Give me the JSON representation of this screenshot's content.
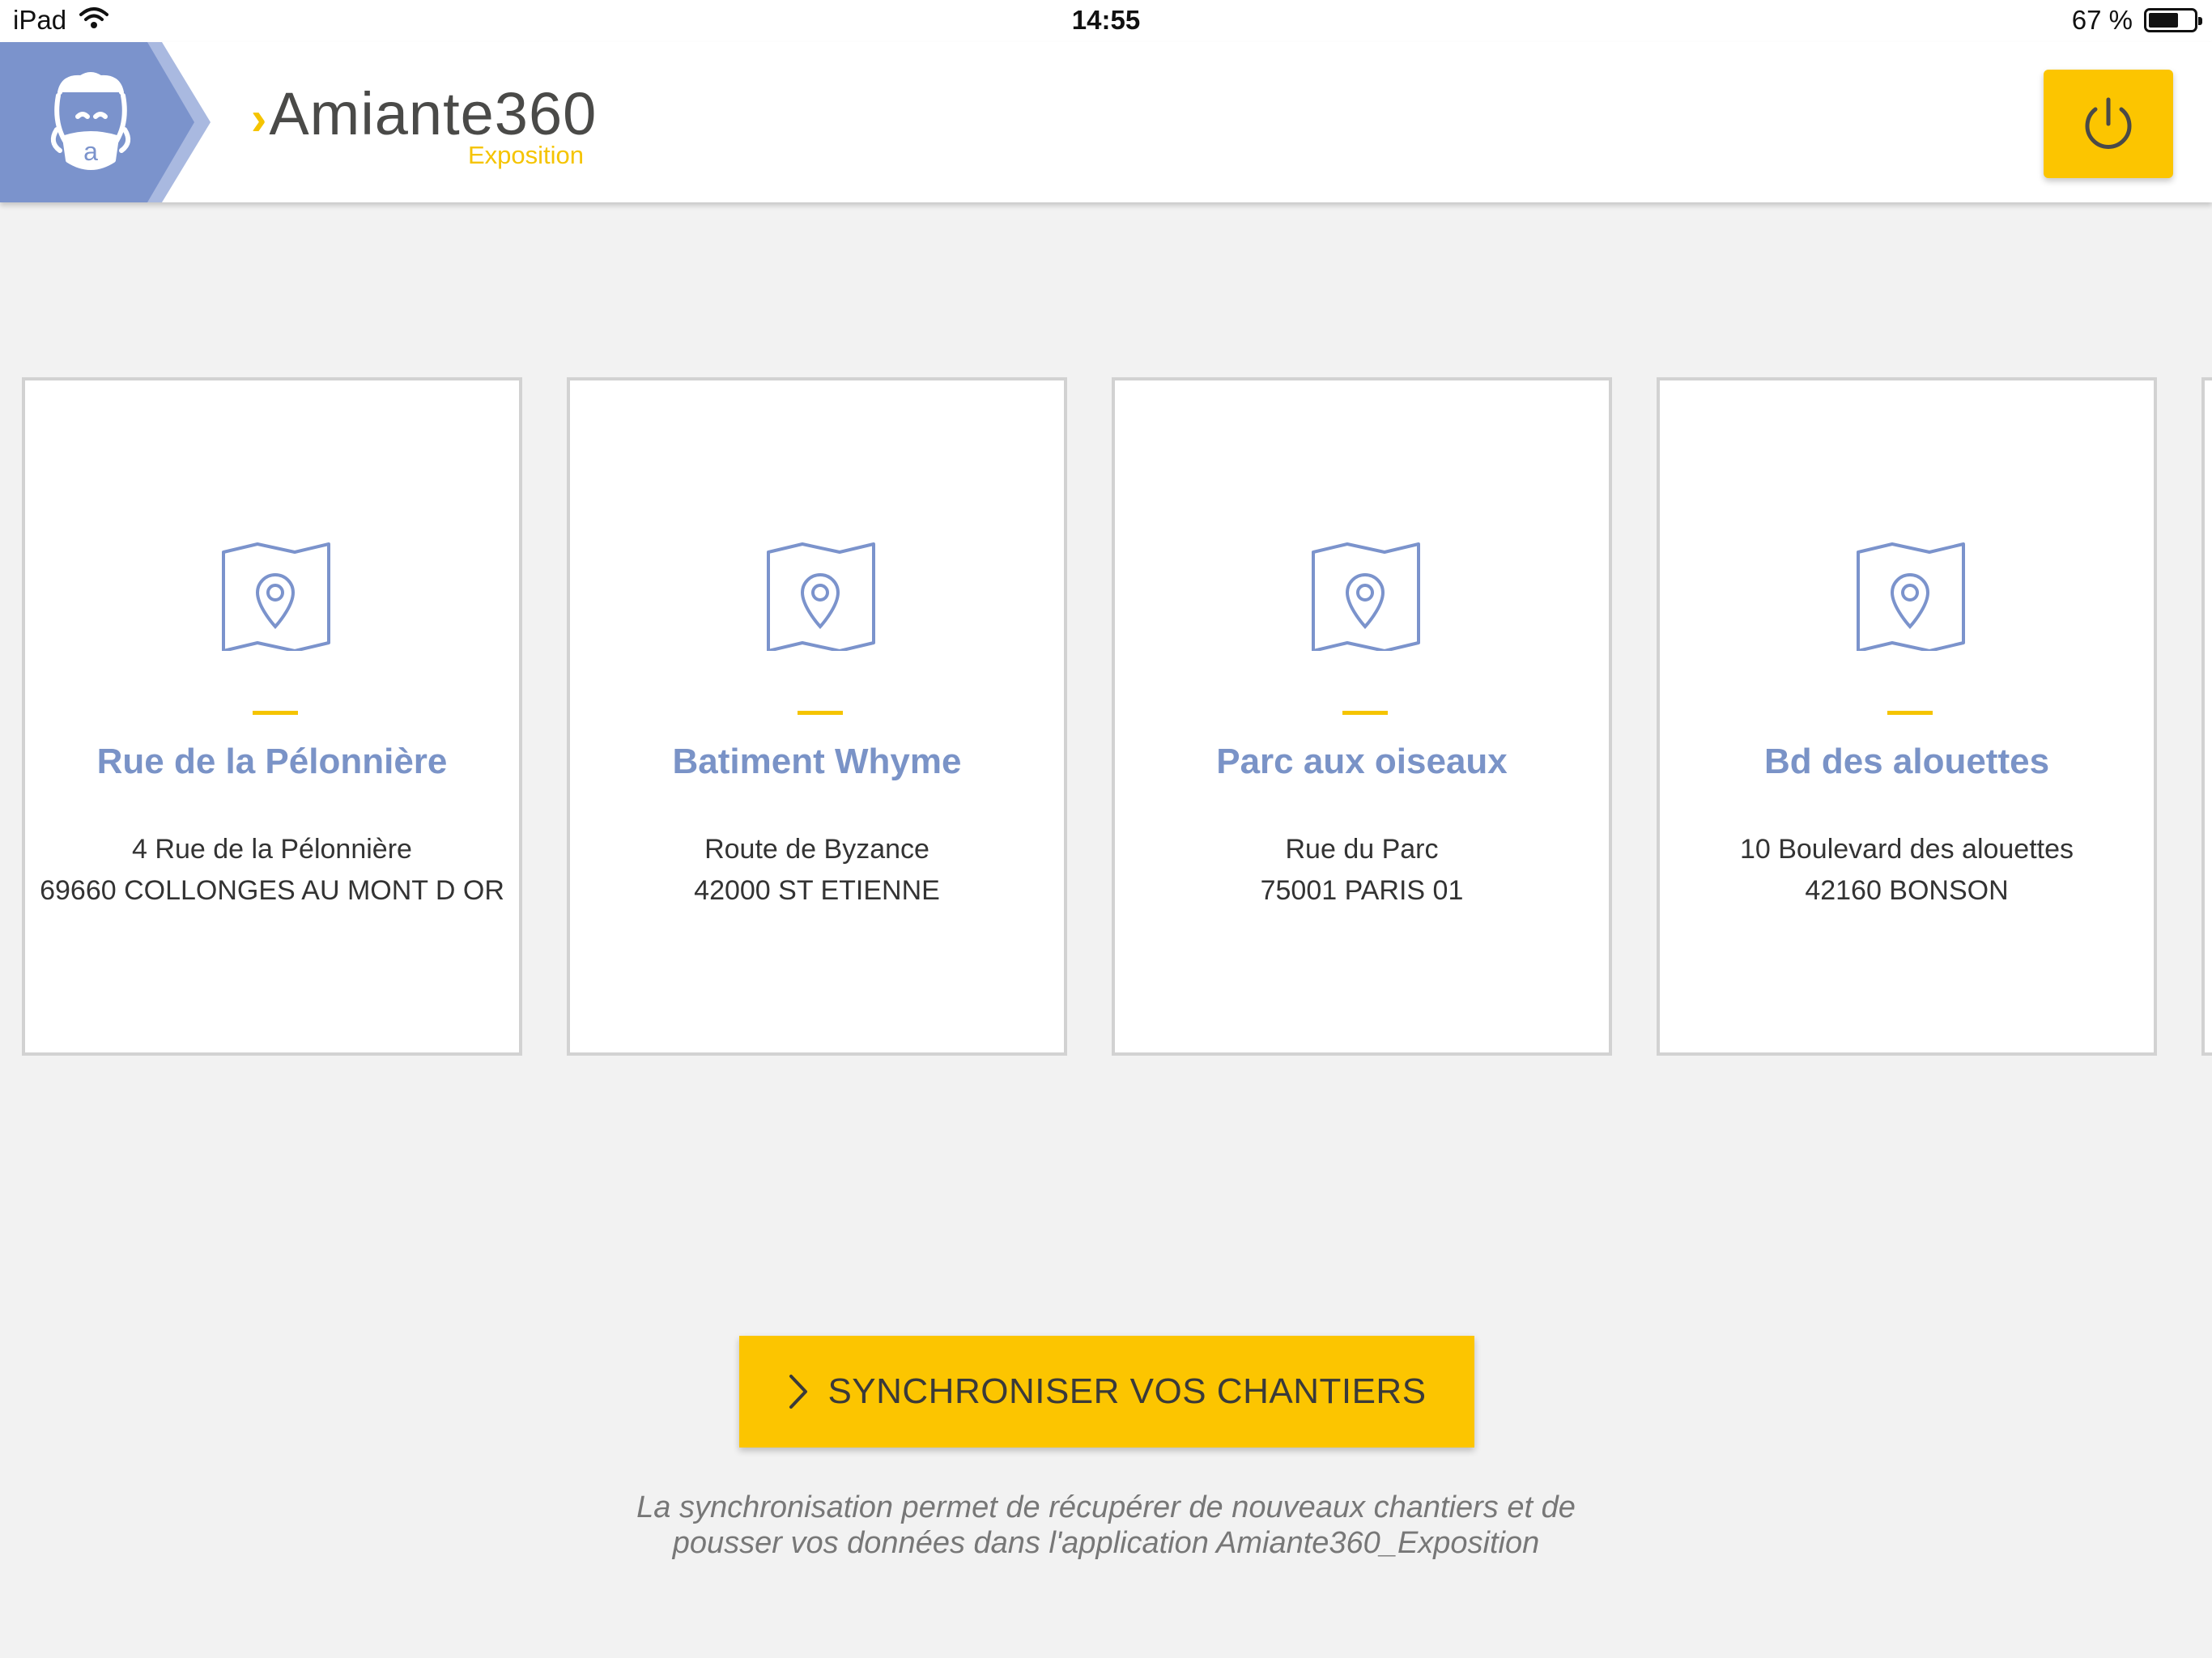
{
  "statusbar": {
    "device": "iPad",
    "time": "14:55",
    "battery": "67 %",
    "battery_level": 0.67,
    "icons": [
      "wifi-icon",
      "battery-icon"
    ]
  },
  "header": {
    "logo_main": "Amiante360",
    "logo_sub": "Exposition",
    "power_icon": "power-icon",
    "colors": {
      "badge": "#7b93cc",
      "accent": "#fcc500"
    }
  },
  "sites": [
    {
      "name": "Rue de la Pélonnière",
      "address_line1": "4 Rue de la Pélonnière",
      "address_line2": "69660 COLLONGES AU MONT D OR"
    },
    {
      "name": "Batiment Whyme",
      "address_line1": "Route de Byzance",
      "address_line2": "42000 ST ETIENNE"
    },
    {
      "name": "Parc aux oiseaux",
      "address_line1": "Rue du Parc",
      "address_line2": "75001 PARIS 01"
    },
    {
      "name": "Bd des alouettes",
      "address_line1": "10 Boulevard des alouettes",
      "address_line2": "42160 BONSON"
    }
  ],
  "sync": {
    "button_label": "SYNCHRONISER VOS CHANTIERS",
    "note_line1": "La synchronisation permet de récupérer de nouveaux chantiers et de",
    "note_line2": "pousser vos données dans l'application Amiante360_Exposition"
  }
}
